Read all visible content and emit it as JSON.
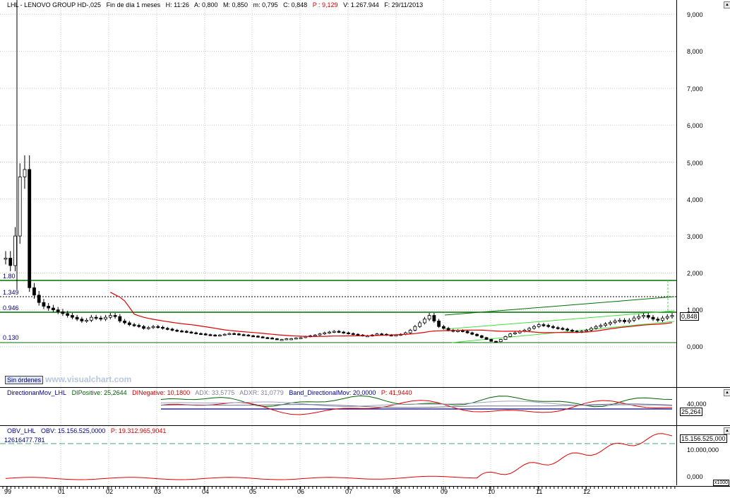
{
  "header": {
    "symbol": "LHL - LENOVO GROUP  HD-,025",
    "period": "Fin de día 1 meses",
    "time": "H: 11:26",
    "open": "A: 0,800",
    "high": "M: 0,850",
    "low": "m: 0,795",
    "close": "C: 0,848",
    "pct": "P : 9,129",
    "volume": "V: 1.267.944",
    "date": "F: 29/11/2013"
  },
  "main": {
    "y_ticks": [
      "9,000",
      "8,000",
      "7,000",
      "6,000",
      "5,000",
      "4,000",
      "3,000",
      "2,000",
      "1,000",
      "0,000"
    ],
    "levels": [
      "1.80",
      "1.349",
      "0.946",
      "0.130"
    ],
    "last_price": "0,848",
    "orders_label": "Sin órdenes",
    "watermark": "www.visualchart.com"
  },
  "dm": {
    "title": "DirectionanMov_LHL",
    "dip": "DIPositive: 25,2644",
    "din": "DINegative: 10,1800",
    "adx": "ADX: 33,5775",
    "adxr": "ADXR: 31,0779",
    "band": "Band_DirectionalMov: 20,0000",
    "p": "P: 41,9440",
    "y_ticks": [
      "40,000"
    ],
    "last": "25,264"
  },
  "obv": {
    "title": "OBV_LHL",
    "value": "OBV: 15.156.525,0000",
    "p": "P: 19.312.965,9041",
    "ref": "12616477.781",
    "y_ticks": [
      "10.000,000",
      "0,000"
    ],
    "last": "15.156.525,000",
    "scale": "x1000"
  },
  "time_axis": {
    "labels": [
      "99",
      "01",
      "02",
      "03",
      "04",
      "05",
      "06",
      "07",
      "08",
      "09",
      "10",
      "11",
      "12"
    ]
  },
  "colors": {
    "green": "#007000",
    "lightgreen": "#40e040",
    "red": "#e00000",
    "grid": "#c8c8c8",
    "navy": "#000080"
  }
}
